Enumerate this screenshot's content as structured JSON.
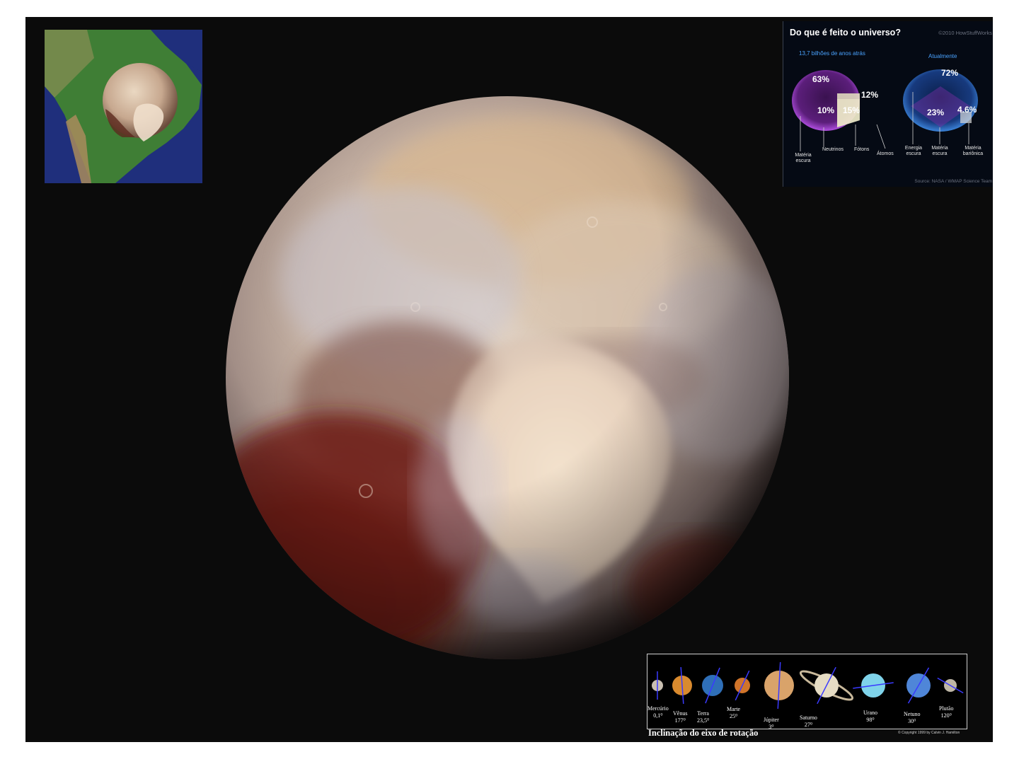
{
  "universe": {
    "title": "Do que é feito o universo?",
    "copyright": "©2010 HowStuffWorks",
    "past": {
      "heading": "13,7 bilhões de anos atrás",
      "pct_dark_matter": "63%",
      "pct_photons": "12%",
      "pct_neutrinos": "10%",
      "pct_atoms": "15%"
    },
    "now": {
      "heading": "Atualmente",
      "pct_dark_energy": "72%",
      "pct_dark_matter": "23%",
      "pct_baryonic": "4.6%"
    },
    "labels": {
      "dark_matter": "Matéria escura",
      "neutrinos": "Neutrinos",
      "photons": "Fótons",
      "atoms": "Átomos",
      "dark_energy": "Energia escura",
      "dark_matter_now": "Matéria escura",
      "baryonic": "Matéria bariônica"
    },
    "source": "Source: NASA / WMAP Science Team"
  },
  "tilt": {
    "caption": "Inclinação do eixo de rotação",
    "copyright": "© Copyright 1999 by Calvin J. Hamilton",
    "planets": [
      {
        "name": "Mercúrio",
        "tilt": "0,1⁰",
        "color": "#c9bfb1"
      },
      {
        "name": "Vênus",
        "tilt": "177⁰",
        "color": "#d98a2e"
      },
      {
        "name": "Terra",
        "tilt": "23,5⁰",
        "color": "#2f6fb8"
      },
      {
        "name": "Marte",
        "tilt": "25⁰",
        "color": "#d0742a"
      },
      {
        "name": "Júpiter",
        "tilt": "3⁰",
        "color": "#d9a36a"
      },
      {
        "name": "Saturno",
        "tilt": "27⁰",
        "color": "#e6dcc4"
      },
      {
        "name": "Urano",
        "tilt": "98⁰",
        "color": "#7fd3ea"
      },
      {
        "name": "Netuno",
        "tilt": "30⁰",
        "color": "#4f86d8"
      },
      {
        "name": "Plutão",
        "tilt": "120⁰",
        "color": "#bfb7a6"
      }
    ]
  }
}
